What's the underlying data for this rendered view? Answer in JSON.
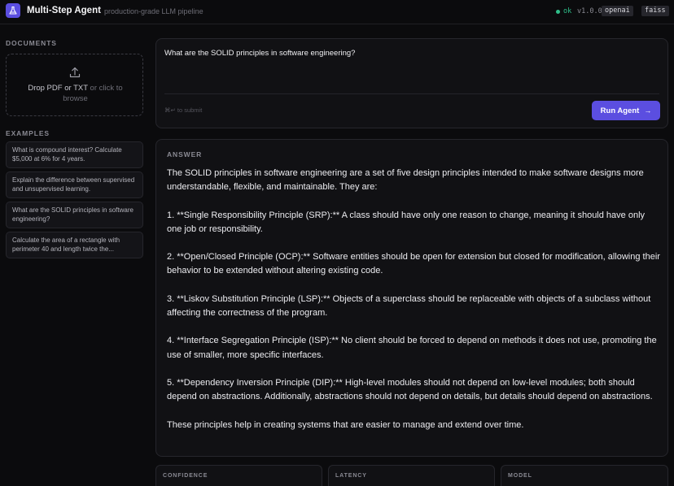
{
  "header": {
    "title": "Multi-Step Agent",
    "subtitle": "production-grade LLM pipeline",
    "status": "ok",
    "version": "v1.0.0",
    "badges": [
      "openai",
      "faiss"
    ],
    "status_color": "#2fbf8a",
    "logo_icon": "flask-icon"
  },
  "sidebar": {
    "documents_label": "DOCUMENTS",
    "dropzone": {
      "primary": "Drop PDF or TXT",
      "secondary": "or click to browse",
      "icon": "upload-icon"
    },
    "examples_label": "EXAMPLES",
    "examples": [
      "What is compound interest? Calculate $5,000 at 6% for 4 years.",
      "Explain the difference between supervised and unsupervised learning.",
      "What are the SOLID principles in software engineering?",
      "Calculate the area of a rectangle with perimeter 40 and length twice the..."
    ]
  },
  "query": {
    "value": "What are the SOLID principles in software engineering?",
    "hint": "⌘↵ to submit",
    "run_label": "Run Agent",
    "accent": "#5b4ee0"
  },
  "answer": {
    "label": "ANSWER",
    "paragraphs": [
      "The SOLID principles in software engineering are a set of five design principles intended to make software designs more understandable, flexible, and maintainable. They are:",
      "1. **Single Responsibility Principle (SRP):** A class should have only one reason to change, meaning it should have only one job or responsibility.",
      "2. **Open/Closed Principle (OCP):** Software entities should be open for extension but closed for modification, allowing their behavior to be extended without altering existing code.",
      "3. **Liskov Substitution Principle (LSP):** Objects of a superclass should be replaceable with objects of a subclass without affecting the correctness of the program.",
      "4. **Interface Segregation Principle (ISP):** No client should be forced to depend on methods it does not use, promoting the use of smaller, more specific interfaces.",
      "5. **Dependency Inversion Principle (DIP):** High-level modules should not depend on low-level modules; both should depend on abstractions. Additionally, abstractions should not depend on details, but details should depend on abstractions.",
      "These principles help in creating systems that are easier to manage and extend over time."
    ]
  },
  "metrics": [
    {
      "label": "CONFIDENCE"
    },
    {
      "label": "LATENCY"
    },
    {
      "label": "MODEL"
    }
  ]
}
